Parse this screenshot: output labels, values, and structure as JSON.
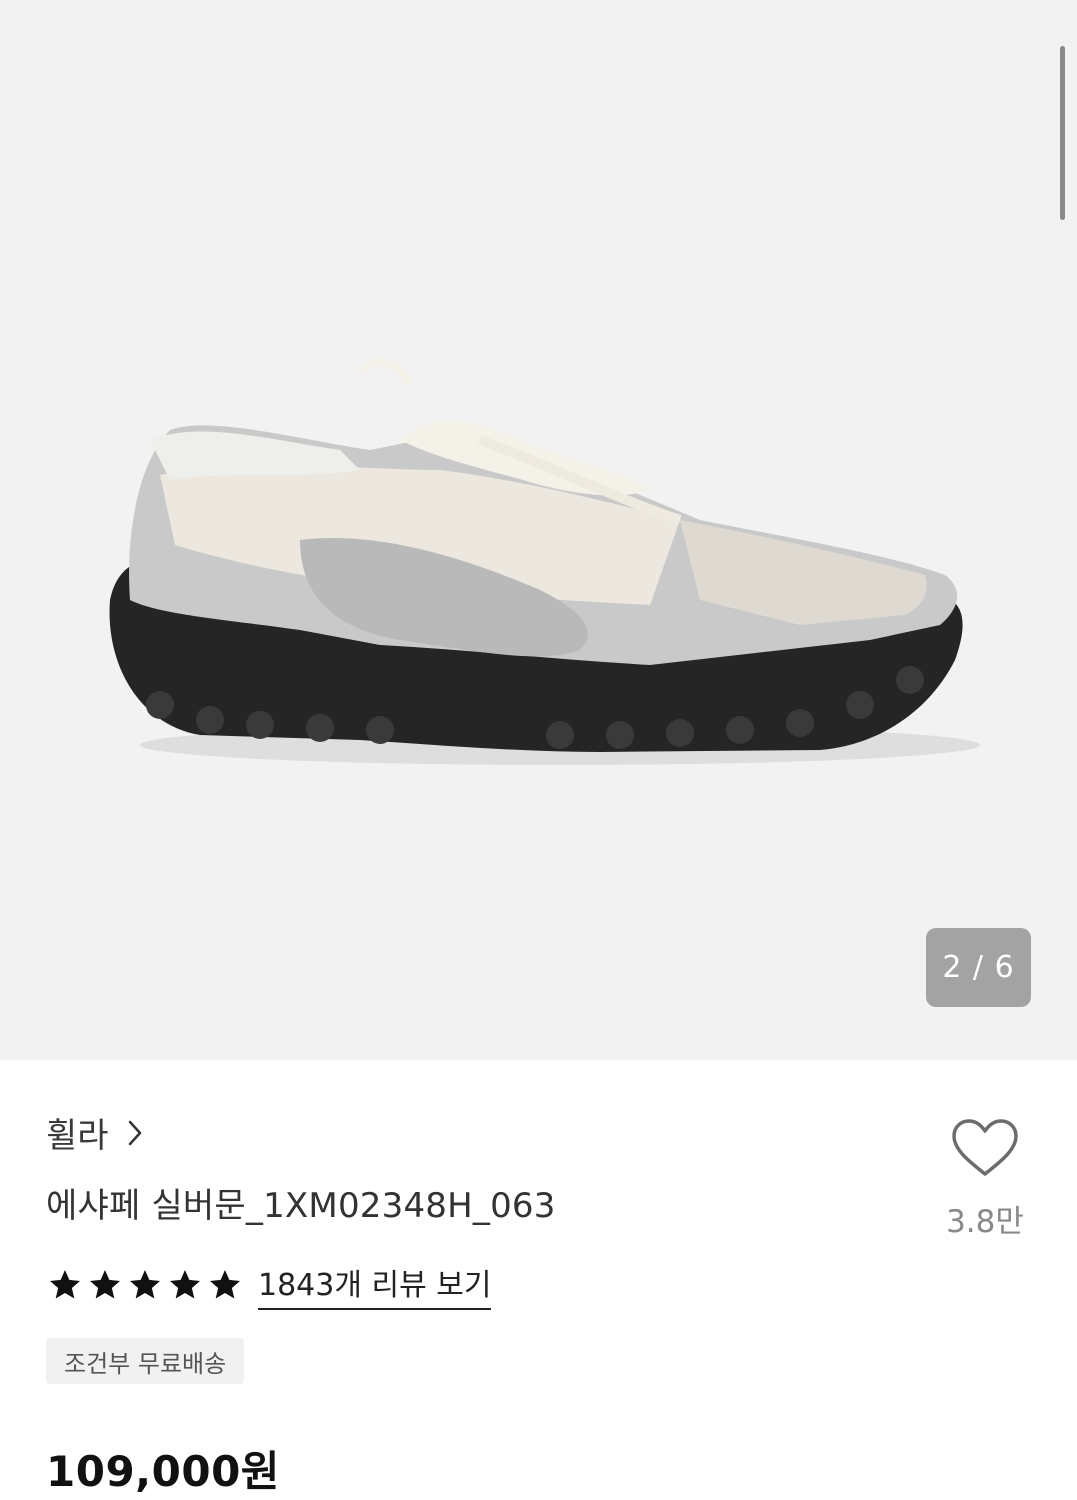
{
  "gallery": {
    "current": "2 / 6",
    "image_alt": "shoe-product-photo"
  },
  "product": {
    "brand": "휠라",
    "name": "에샤페 실버문_1XM02348H_063",
    "like_count": "3.8만",
    "rating": {
      "stars": 5
    },
    "review_link": "1843개 리뷰 보기",
    "shipping_badge": "조건부 무료배송",
    "price": "109,000원"
  }
}
